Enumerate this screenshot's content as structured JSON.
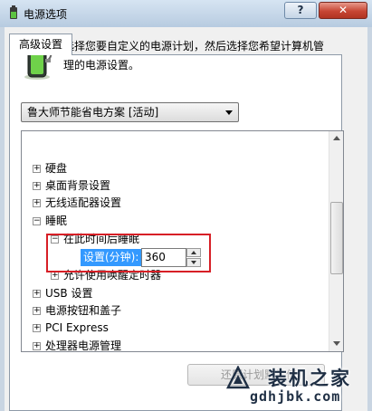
{
  "window": {
    "title": "电源选项",
    "help_label": "?",
    "close_label": "✕"
  },
  "tab": {
    "label": "高级设置"
  },
  "description": "选择您要自定义的电源计划，然后选择您希望计算机管理的电源设置。",
  "plan_dropdown": {
    "selected": "鲁大师节能省电方案 [活动]"
  },
  "tree": {
    "items": [
      {
        "expander": "+",
        "label": "硬盘"
      },
      {
        "expander": "+",
        "label": "桌面背景设置"
      },
      {
        "expander": "+",
        "label": "无线适配器设置"
      },
      {
        "expander": "−",
        "label": "睡眠"
      },
      {
        "expander": "−",
        "label": "在此时间后睡眠"
      },
      {
        "expander": "+",
        "label": "允许使用唤醒定时器"
      },
      {
        "expander": "+",
        "label": "USB 设置"
      },
      {
        "expander": "+",
        "label": "电源按钮和盖子"
      },
      {
        "expander": "+",
        "label": "PCI Express"
      },
      {
        "expander": "+",
        "label": "处理器电源管理"
      }
    ],
    "setting": {
      "label": "设置(分钟):",
      "value": "360"
    }
  },
  "restore_button": {
    "label": "还原计划默认值"
  },
  "watermark": {
    "text": "装机之家",
    "url": "gdhjbk.com"
  },
  "colors": {
    "highlight_border": "#d71f26",
    "selection": "#3399ff",
    "titlebar": "#c9d5e2"
  }
}
